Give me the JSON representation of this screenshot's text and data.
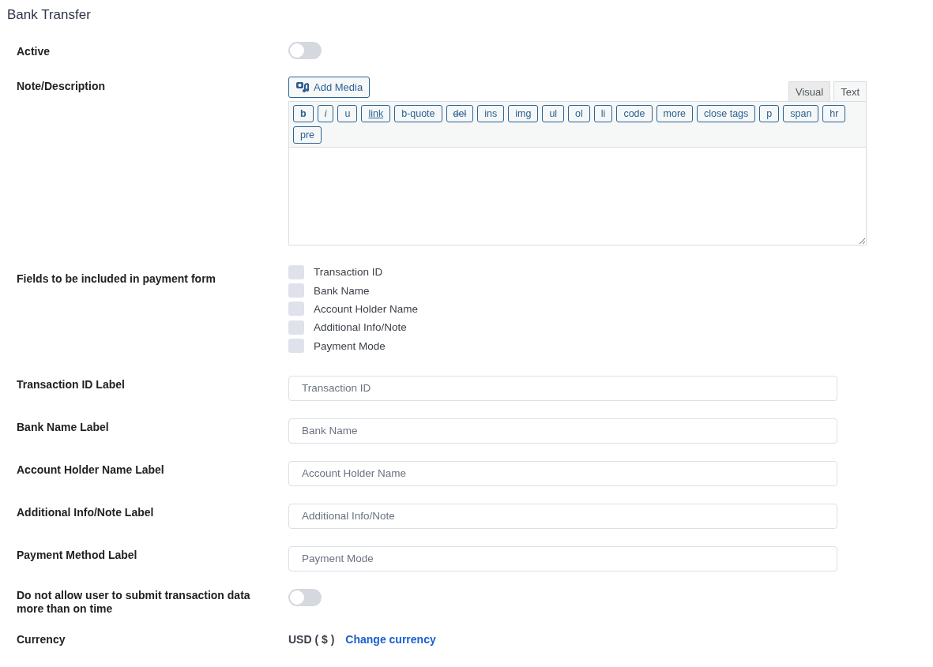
{
  "title": "Bank Transfer",
  "settings": [
    {
      "kind": "toggle",
      "label": "Active",
      "on": false
    },
    {
      "kind": "editor",
      "label": "Note/Description",
      "add_media": "Add Media",
      "tabs": [
        {
          "label": "Visual",
          "selected": false
        },
        {
          "label": "Text",
          "selected": true
        }
      ],
      "quicktags": [
        {
          "label": "b",
          "kind": "bold"
        },
        {
          "label": "i",
          "kind": "italic"
        },
        {
          "label": "u",
          "kind": "plain"
        },
        {
          "label": "link",
          "kind": "underline"
        },
        {
          "label": "b-quote",
          "kind": "plain"
        },
        {
          "label": "del",
          "kind": "strike"
        },
        {
          "label": "ins",
          "kind": "plain"
        },
        {
          "label": "img",
          "kind": "plain"
        },
        {
          "label": "ul",
          "kind": "plain"
        },
        {
          "label": "ol",
          "kind": "plain"
        },
        {
          "label": "li",
          "kind": "plain"
        },
        {
          "label": "code",
          "kind": "plain"
        },
        {
          "label": "more",
          "kind": "plain"
        },
        {
          "label": "close tags",
          "kind": "plain"
        },
        {
          "label": "p",
          "kind": "plain"
        },
        {
          "label": "span",
          "kind": "plain"
        },
        {
          "label": "hr",
          "kind": "plain"
        },
        {
          "label": "pre",
          "kind": "plain"
        }
      ]
    },
    {
      "kind": "checkboxes",
      "label": "Fields to be included in payment form",
      "options": [
        {
          "label": "Transaction ID",
          "checked": false
        },
        {
          "label": "Bank Name",
          "checked": false
        },
        {
          "label": "Account Holder Name",
          "checked": false
        },
        {
          "label": "Additional Info/Note",
          "checked": false
        },
        {
          "label": "Payment Mode",
          "checked": false
        }
      ]
    },
    {
      "kind": "text",
      "label": "Transaction ID Label",
      "placeholder": "Transaction ID"
    },
    {
      "kind": "text",
      "label": "Bank Name Label",
      "placeholder": "Bank Name"
    },
    {
      "kind": "text",
      "label": "Account Holder Name Label",
      "placeholder": "Account Holder Name"
    },
    {
      "kind": "text",
      "label": "Additional Info/Note Label",
      "placeholder": "Additional Info/Note"
    },
    {
      "kind": "text",
      "label": "Payment Method Label",
      "placeholder": "Payment Mode"
    },
    {
      "kind": "toggle",
      "label": "Do not allow user to submit transaction data more than on time",
      "on": false
    },
    {
      "kind": "currency",
      "label": "Currency",
      "value": "USD ( $ )",
      "link": "Change currency"
    }
  ]
}
